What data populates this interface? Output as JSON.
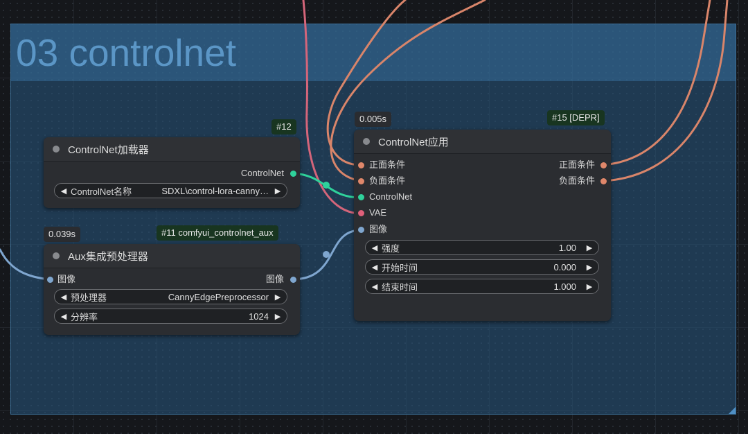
{
  "group": {
    "title": "03 controlnet",
    "color": "#3a78a8"
  },
  "nodes": {
    "controlnet_loader": {
      "badge": "#12",
      "title": "ControlNet加载器",
      "outputs": [
        {
          "label": "ControlNet",
          "color": "#2fd29b"
        }
      ],
      "widgets": [
        {
          "label": "ControlNet名称",
          "value": "SDXL\\control-lora-canny…"
        }
      ]
    },
    "aux_preprocessor": {
      "time": "0.039s",
      "badge": "#11 comfyui_controlnet_aux",
      "title": "Aux集成预处理器",
      "inputs": [
        {
          "label": "图像",
          "color": "#7fa6cf"
        }
      ],
      "outputs": [
        {
          "label": "图像",
          "color": "#7fa6cf"
        }
      ],
      "widgets": [
        {
          "label": "预处理器",
          "value": "CannyEdgePreprocessor"
        },
        {
          "label": "分辨率",
          "value": "1024"
        }
      ]
    },
    "controlnet_apply": {
      "time": "0.005s",
      "badge": "#15 [DEPR]",
      "title": "ControlNet应用",
      "inputs": [
        {
          "label": "正面条件",
          "color": "#e0876a"
        },
        {
          "label": "负面条件",
          "color": "#e0876a"
        },
        {
          "label": "ControlNet",
          "color": "#2fd29b"
        },
        {
          "label": "VAE",
          "color": "#e0607a"
        },
        {
          "label": "图像",
          "color": "#7fa6cf"
        }
      ],
      "outputs": [
        {
          "label": "正面条件",
          "color": "#e0876a"
        },
        {
          "label": "负面条件",
          "color": "#e0876a"
        }
      ],
      "widgets": [
        {
          "label": "强度",
          "value": "1.00"
        },
        {
          "label": "开始时间",
          "value": "0.000"
        },
        {
          "label": "结束时间",
          "value": "1.000"
        }
      ]
    }
  },
  "colors": {
    "conditioning": "#e0876a",
    "controlnet": "#2fd29b",
    "vae": "#e0607a",
    "image": "#7fa6cf"
  }
}
